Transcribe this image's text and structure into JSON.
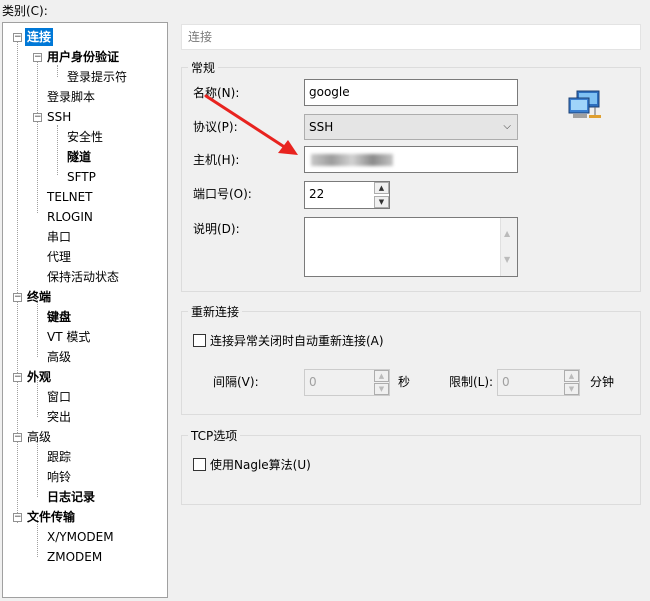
{
  "window": {
    "category_label": "类别(C):"
  },
  "tree": {
    "items": [
      {
        "label": "连接",
        "bold": true,
        "selected": true
      },
      {
        "label": "用户身份验证",
        "bold": true
      },
      {
        "label": "登录提示符"
      },
      {
        "label": "登录脚本"
      },
      {
        "label": "SSH"
      },
      {
        "label": "安全性"
      },
      {
        "label": "隧道",
        "bold": true
      },
      {
        "label": "SFTP"
      },
      {
        "label": "TELNET"
      },
      {
        "label": "RLOGIN"
      },
      {
        "label": "串口"
      },
      {
        "label": "代理"
      },
      {
        "label": "保持活动状态"
      },
      {
        "label": "终端",
        "bold": true
      },
      {
        "label": "键盘",
        "bold": true
      },
      {
        "label": "VT 模式"
      },
      {
        "label": "高级"
      },
      {
        "label": "外观",
        "bold": true
      },
      {
        "label": "窗口"
      },
      {
        "label": "突出"
      },
      {
        "label": "高级"
      },
      {
        "label": "跟踪"
      },
      {
        "label": "响铃"
      },
      {
        "label": "日志记录",
        "bold": true
      },
      {
        "label": "文件传输",
        "bold": true
      },
      {
        "label": "X/YMODEM"
      },
      {
        "label": "ZMODEM"
      }
    ]
  },
  "panel": {
    "title": "连接",
    "general": {
      "title": "常规",
      "name_label": "名称(N):",
      "name_value": "google",
      "protocol_label": "协议(P):",
      "protocol_value": "SSH",
      "host_label": "主机(H):",
      "port_label": "端口号(O):",
      "port_value": "22",
      "desc_label": "说明(D):",
      "desc_value": ""
    },
    "reconnect": {
      "title": "重新连接",
      "auto_reconnect_label": "连接异常关闭时自动重新连接(A)",
      "auto_reconnect_checked": false,
      "interval_label": "间隔(V):",
      "interval_value": "0",
      "interval_unit": "秒",
      "limit_label": "限制(L):",
      "limit_value": "0",
      "limit_unit": "分钟"
    },
    "tcp": {
      "title": "TCP选项",
      "nagle_label": "使用Nagle算法(U)",
      "nagle_checked": false
    }
  },
  "colors": {
    "selection": "#0078d7",
    "annotation_arrow": "#e8231f"
  }
}
